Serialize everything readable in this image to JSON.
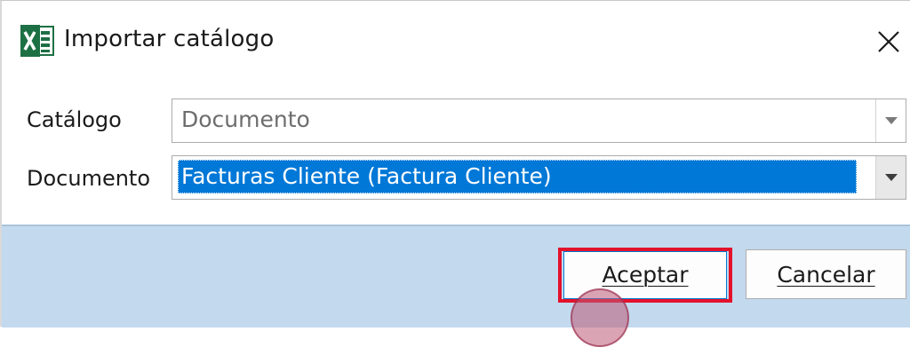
{
  "window": {
    "title": "Importar catálogo",
    "app_icon": "excel-icon",
    "close_icon": "close-icon"
  },
  "form": {
    "catalogo_label": "Catálogo",
    "catalogo_value": "Documento",
    "documento_label": "Documento",
    "documento_value": "Facturas Cliente (Factura Cliente)"
  },
  "buttons": {
    "accept_label": "Aceptar",
    "cancel_label": "Cancelar"
  },
  "colors": {
    "selection": "#0078d7",
    "footer": "#c3d9ee",
    "highlight": "#e3122b",
    "excel_green": "#1d7044"
  }
}
